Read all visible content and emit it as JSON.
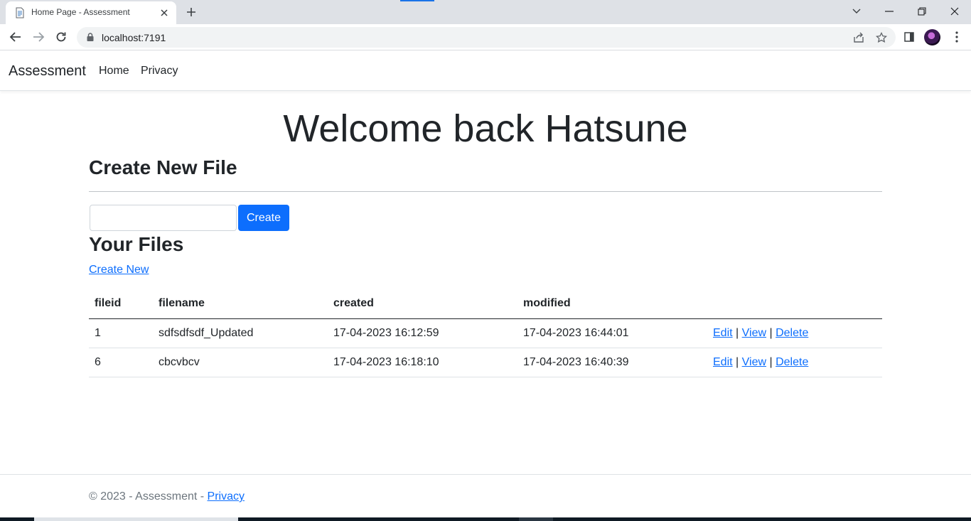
{
  "browser": {
    "tab_title": "Home Page - Assessment",
    "url": "localhost:7191"
  },
  "navbar": {
    "brand": "Assessment",
    "links": [
      "Home",
      "Privacy"
    ]
  },
  "main": {
    "welcome": "Welcome back Hatsune",
    "create_heading": "Create New File",
    "input_value": "",
    "create_button": "Create",
    "files_heading": "Your Files",
    "create_new_link": "Create New",
    "table": {
      "headers": [
        "fileid",
        "filename",
        "created",
        "modified",
        ""
      ],
      "rows": [
        [
          "1",
          "sdfsdfsdf_Updated",
          "17-04-2023 16:12:59",
          "17-04-2023 16:44:01"
        ],
        [
          "6",
          "cbcvbcv",
          "17-04-2023 16:18:10",
          "17-04-2023 16:40:39"
        ]
      ],
      "actions": [
        "Edit",
        "View",
        "Delete"
      ],
      "separator": "|"
    }
  },
  "footer": {
    "text": "© 2023 - Assessment - ",
    "link": "Privacy"
  },
  "colors": {
    "primary": "#0d6efd",
    "tabstrip": "#dee1e6"
  }
}
